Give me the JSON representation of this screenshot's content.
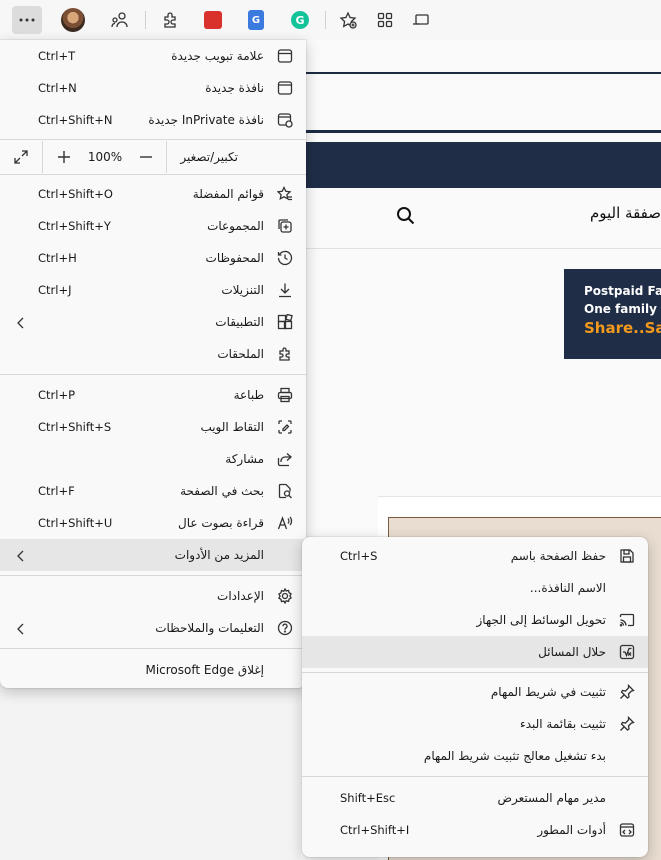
{
  "toolbar": {
    "icons": [
      "more-icon",
      "avatar",
      "companion-icon",
      "extensions-icon",
      "ext-red-icon",
      "ext-translate-icon",
      "grammarly-icon",
      "add-favorite-icon",
      "collections-icon",
      "tablet-icon"
    ],
    "ext_translate_glyph": "G",
    "grammarly_glyph": "G"
  },
  "page": {
    "heading": "صفقة اليوم",
    "banner": {
      "line1": "Postpaid Fa",
      "line2": "One family",
      "line3": "Share..Sa"
    }
  },
  "menu": {
    "items": [
      {
        "label": "علامة تبويب جديدة",
        "shortcut": "Ctrl+T",
        "icon": "new-tab-icon"
      },
      {
        "label": "نافذة جديدة",
        "shortcut": "Ctrl+N",
        "icon": "new-window-icon"
      },
      {
        "label": "نافذة InPrivate جديدة",
        "shortcut": "Ctrl+Shift+N",
        "icon": "inprivate-icon"
      }
    ],
    "zoom": {
      "label": "تكبير/تصغير",
      "value": "100%"
    },
    "items2": [
      {
        "label": "قوائم المفضلة",
        "shortcut": "Ctrl+Shift+O",
        "icon": "favorites-icon"
      },
      {
        "label": "المجموعات",
        "shortcut": "Ctrl+Shift+Y",
        "icon": "collections-icon"
      },
      {
        "label": "المحفوظات",
        "shortcut": "Ctrl+H",
        "icon": "history-icon"
      },
      {
        "label": "التنزيلات",
        "shortcut": "Ctrl+J",
        "icon": "downloads-icon"
      },
      {
        "label": "التطبيقات",
        "shortcut": "",
        "icon": "apps-icon"
      },
      {
        "label": "الملحقات",
        "shortcut": "",
        "icon": "extensions-icon"
      }
    ],
    "items3": [
      {
        "label": "طباعة",
        "shortcut": "Ctrl+P",
        "icon": "print-icon"
      },
      {
        "label": "التقاط الويب",
        "shortcut": "Ctrl+Shift+S",
        "icon": "web-capture-icon"
      },
      {
        "label": "مشاركة",
        "shortcut": "",
        "icon": "share-icon"
      },
      {
        "label": "بحث في الصفحة",
        "shortcut": "Ctrl+F",
        "icon": "find-icon"
      },
      {
        "label": "قراءة بصوت عال",
        "shortcut": "Ctrl+Shift+U",
        "icon": "read-aloud-icon"
      },
      {
        "label": "المزيد من الأدوات",
        "shortcut": "",
        "icon": ""
      }
    ],
    "items4": [
      {
        "label": "الإعدادات",
        "shortcut": "",
        "icon": "settings-icon"
      },
      {
        "label": "التعليمات والملاحظات",
        "shortcut": "",
        "icon": "help-icon"
      }
    ],
    "close_label": "إغلاق Microsoft Edge"
  },
  "submenu": {
    "items": [
      {
        "label": "حفظ الصفحة باسم",
        "shortcut": "Ctrl+S",
        "icon": "save-icon"
      },
      {
        "label": "الاسم النافذة...",
        "shortcut": "",
        "icon": ""
      },
      {
        "label": "تحويل الوسائط إلى الجهاز",
        "shortcut": "",
        "icon": "cast-icon"
      },
      {
        "label": "حلال المسائل",
        "shortcut": "",
        "icon": "math-solver-icon"
      }
    ],
    "items2": [
      {
        "label": "تثبيت في شريط المهام",
        "shortcut": "",
        "icon": "pin-icon"
      },
      {
        "label": "تثبيت بقائمة البدء",
        "shortcut": "",
        "icon": "pin-start-icon"
      },
      {
        "label": "بدء تشغيل معالج تثبيت شريط المهام",
        "shortcut": "",
        "icon": ""
      }
    ],
    "items3": [
      {
        "label": "مدير مهام المستعرض",
        "shortcut": "Shift+Esc",
        "icon": ""
      },
      {
        "label": "أدوات المطور",
        "shortcut": "Ctrl+Shift+I",
        "icon": "dev-tools-icon"
      }
    ]
  }
}
